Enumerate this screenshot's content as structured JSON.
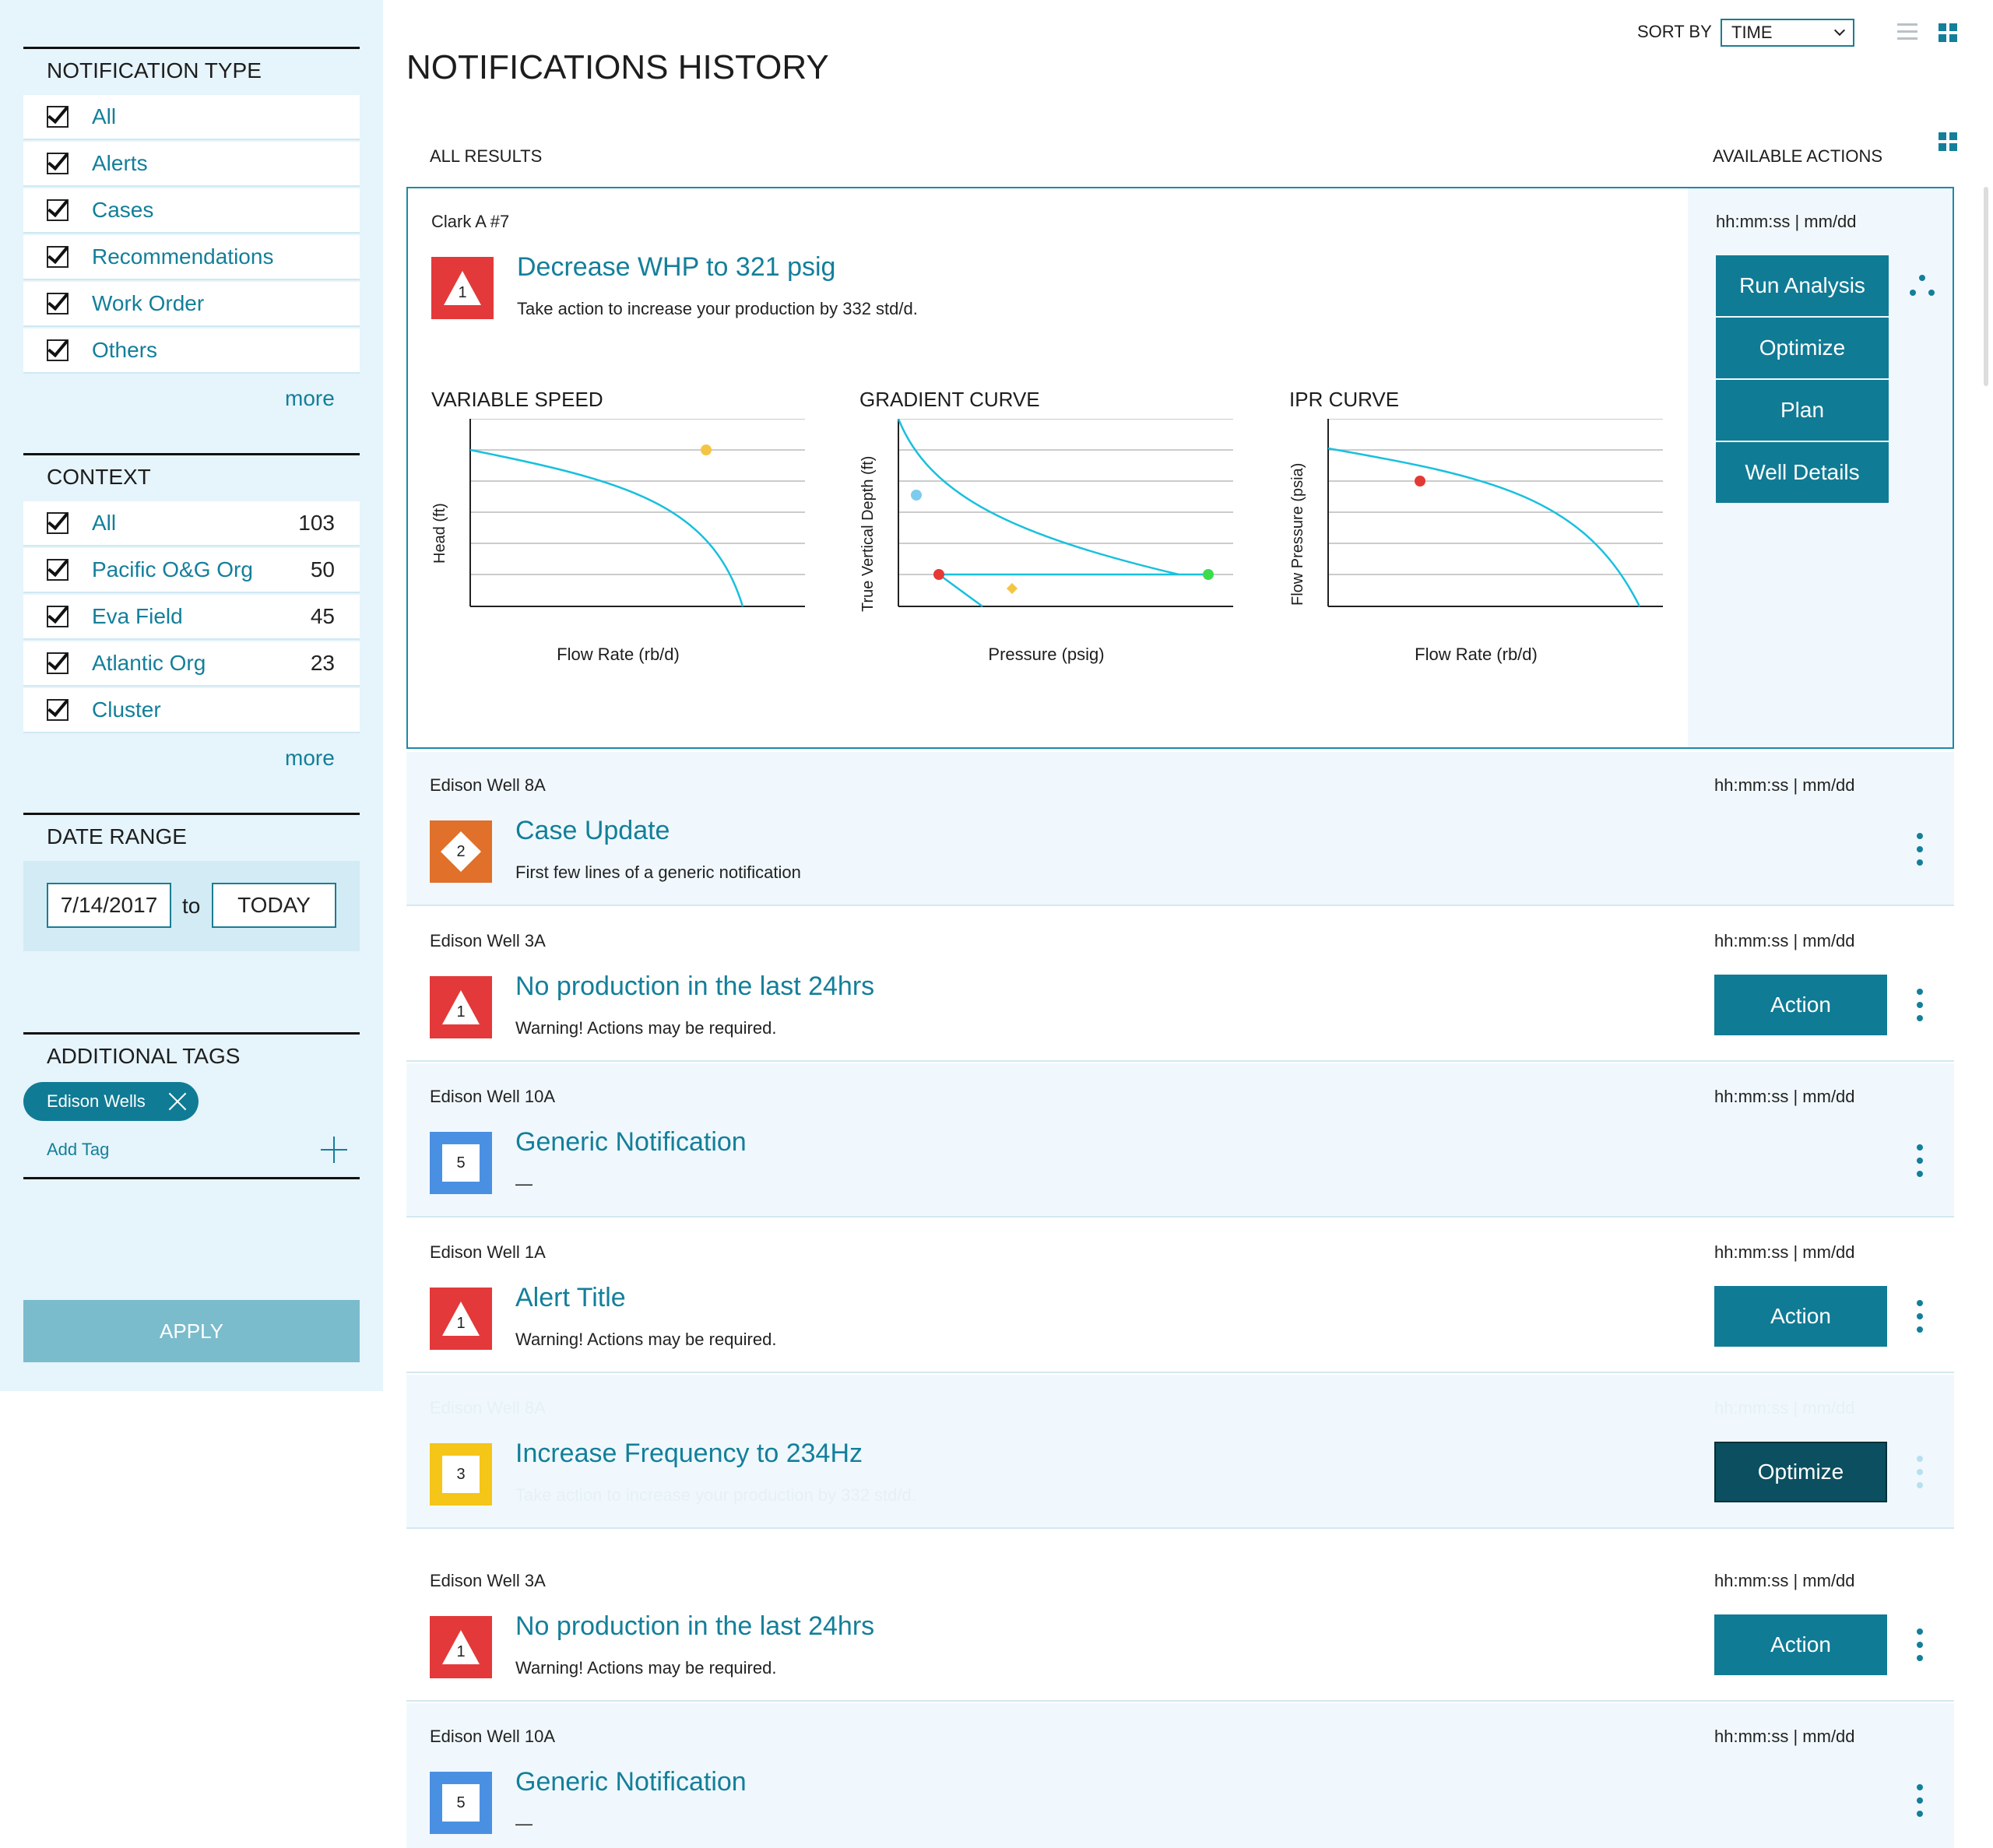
{
  "sidebar": {
    "notification_type": {
      "heading": "NOTIFICATION TYPE",
      "items": [
        "All",
        "Alerts",
        "Cases",
        "Recommendations",
        "Work Order",
        "Others"
      ],
      "more": "more"
    },
    "context": {
      "heading": "CONTEXT",
      "items": [
        {
          "label": "All",
          "count": "103"
        },
        {
          "label": "Pacific O&G Org",
          "count": "50"
        },
        {
          "label": "Eva Field",
          "count": "45"
        },
        {
          "label": "Atlantic Org",
          "count": "23"
        },
        {
          "label": "Cluster",
          "count": ""
        }
      ],
      "more": "more"
    },
    "date_range": {
      "heading": "DATE RANGE",
      "from": "7/14/2017",
      "to_label": "to",
      "to": "TODAY"
    },
    "tags": {
      "heading": "ADDITIONAL TAGS",
      "chip": "Edison Wells",
      "add": "Add Tag"
    },
    "apply": "APPLY"
  },
  "header": {
    "title": "NOTIFICATIONS HISTORY",
    "sort_label": "SORT BY",
    "sort_value": "TIME"
  },
  "list_header": {
    "left": "ALL RESULTS",
    "right": "AVAILABLE ACTIONS"
  },
  "expanded": {
    "well": "Clark A #7",
    "time": "hh:mm:ss  |  mm/dd",
    "badge": "1",
    "title": "Decrease WHP to 321 psig",
    "subtitle": "Take action to increase your production by 332 std/d.",
    "actions": [
      "Run Analysis",
      "Optimize",
      "Plan",
      "Well Details"
    ],
    "charts": [
      {
        "title": "VARIABLE SPEED",
        "ylabel": "Head (ft)",
        "xlabel": "Flow Rate (rb/d)"
      },
      {
        "title": "GRADIENT CURVE",
        "ylabel": "True Vertical Depth (ft)",
        "xlabel": "Pressure (psig)"
      },
      {
        "title": "IPR CURVE",
        "ylabel": "Flow Pressure (psia)",
        "xlabel": "Flow Rate (rb/d)"
      }
    ]
  },
  "cards": [
    {
      "well": "Edison Well 8A",
      "time": "hh:mm:ss  |  mm/dd",
      "badge": "2",
      "title": "Case Update",
      "subtitle": "First few lines of a generic notification",
      "action": ""
    },
    {
      "well": "Edison Well 3A",
      "time": "hh:mm:ss  |  mm/dd",
      "badge": "1",
      "title": "No production in the last 24hrs",
      "subtitle": "Warning! Actions may be required.",
      "action": "Action"
    },
    {
      "well": "Edison Well 10A",
      "time": "hh:mm:ss  |  mm/dd",
      "badge": "5",
      "title": "Generic Notification",
      "subtitle": "—",
      "action": ""
    },
    {
      "well": "Edison Well 1A",
      "time": "hh:mm:ss  |  mm/dd",
      "badge": "1",
      "title": "Alert Title",
      "subtitle": "Warning! Actions may be required.",
      "action": "Action"
    },
    {
      "well": "Edison Well 8A",
      "time": "hh:mm:ss  |  mm/dd",
      "badge": "3",
      "title": "Increase Frequency to 234Hz",
      "subtitle": "Take action to increase your production by 332 std/d.",
      "action": "Optimize"
    },
    {
      "well": "Edison Well 3A",
      "time": "hh:mm:ss  |  mm/dd",
      "badge": "1",
      "title": "No production in the last 24hrs",
      "subtitle": "Warning! Actions may be required.",
      "action": "Action"
    },
    {
      "well": "Edison Well 10A",
      "time": "hh:mm:ss  |  mm/dd",
      "badge": "5",
      "title": "Generic Notification",
      "subtitle": "—",
      "action": ""
    }
  ],
  "colors": {
    "accent": "#137f9a",
    "button": "#107b95",
    "alert": "#e3393a",
    "case": "#e0702a",
    "generic": "#4a90e2",
    "rec": "#f5c518",
    "curve": "#18c0de"
  }
}
